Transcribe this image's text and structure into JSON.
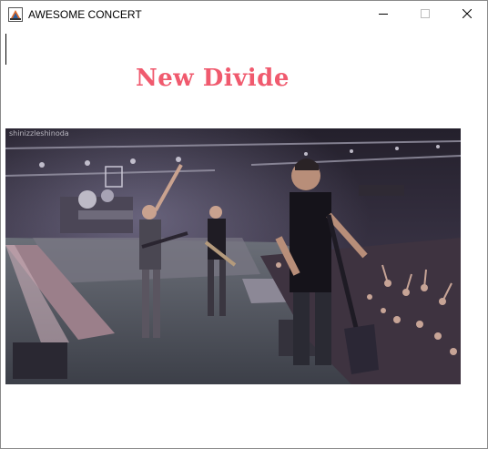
{
  "window": {
    "title": "AWESOME CONCERT",
    "buttons": {
      "minimize": "minimize-icon",
      "maximize": "maximize-icon",
      "close": "close-icon"
    }
  },
  "content": {
    "song_title": "New Divide",
    "title_color": "#f05a6e",
    "image_watermark": "shinizzleshinoda",
    "image_subject": "concert-stage-photo"
  }
}
